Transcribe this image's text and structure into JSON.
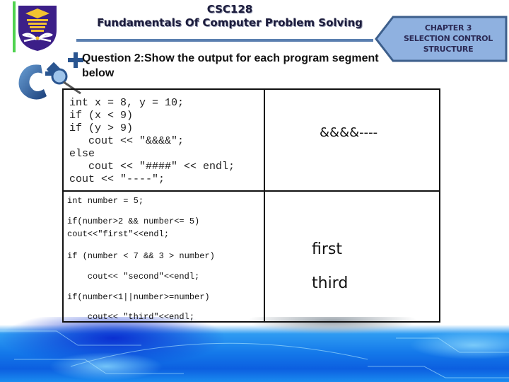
{
  "header": {
    "course_code": "CSC128",
    "course_title": "Fundamentals Of Computer Problem Solving"
  },
  "chapter_tag": {
    "line1": "CHAPTER 3",
    "line2": "SELECTION CONTROL",
    "line3": "STRUCTURE"
  },
  "logos": {
    "university": "uitm-crest-icon",
    "language": "cpp-logo-icon"
  },
  "question": {
    "text": "Question 2:Show the output for each program segment below"
  },
  "table": {
    "rows": [
      {
        "code": [
          "int x = 8, y = 10;",
          "if (x < 9)",
          "if (y > 9)",
          "   cout << \"&&&&\";",
          "else",
          "   cout << \"####\" << endl;",
          "cout << \"----\";"
        ],
        "output": [
          "&&&&----"
        ]
      },
      {
        "code": [
          "int number = 5;",
          "if(number>2 && number<= 5)",
          "cout<<\"first\"<<endl;",
          "if (number < 7 && 3 > number)",
          "    cout<< \"second\"<<endl;",
          "if(number<1||number>=number)",
          "    cout<< \"third\"<<endl;"
        ],
        "output": [
          "first",
          "third"
        ]
      }
    ]
  },
  "colors": {
    "title_text": "#1c1c3c",
    "chapter_fill": "#8fb1e0",
    "chapter_border": "#3d5f8c",
    "title_rule": "#5a7fb0",
    "footer_blue": "#1479ea"
  }
}
